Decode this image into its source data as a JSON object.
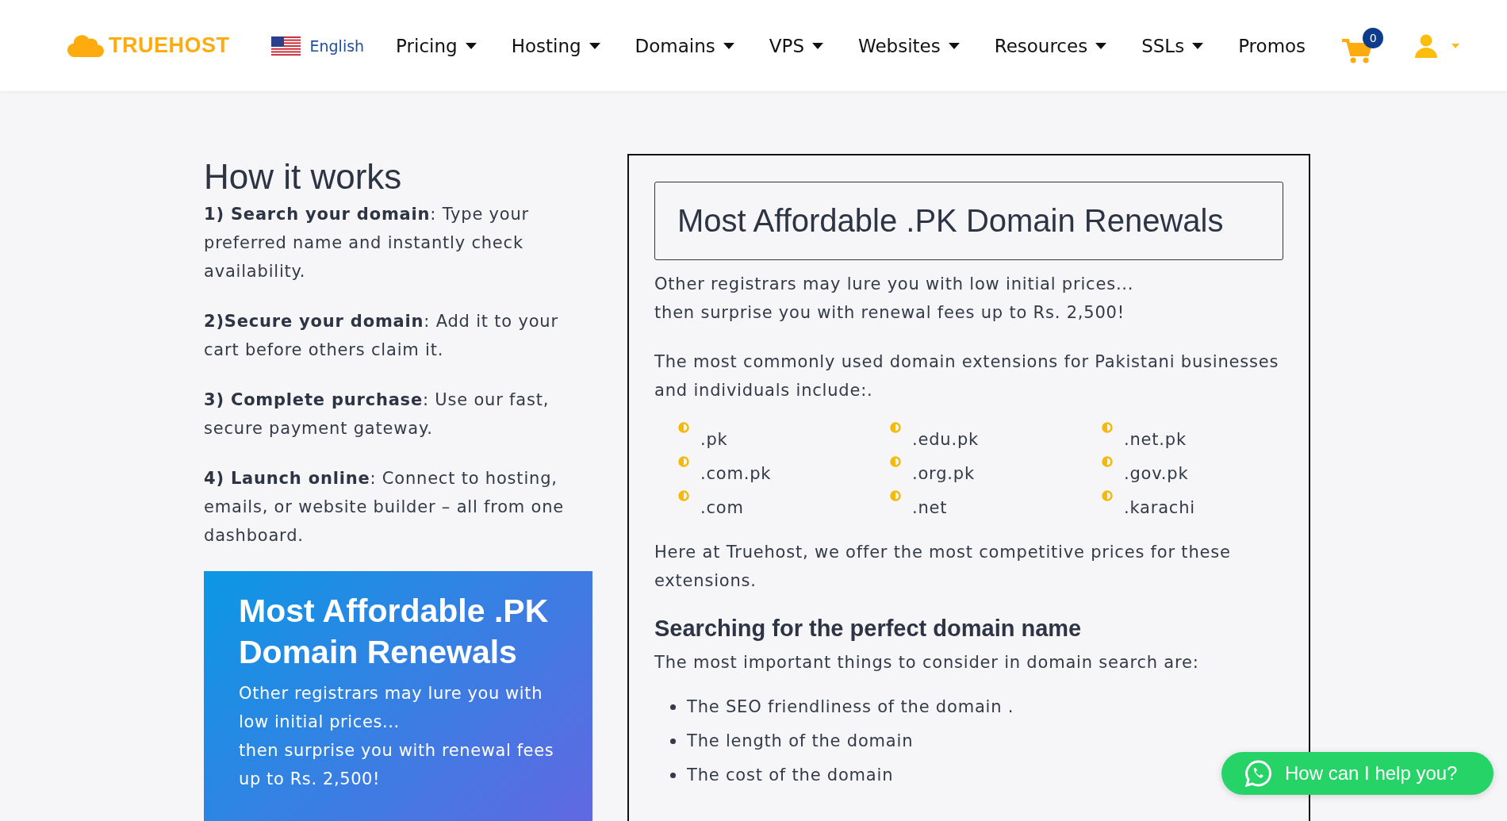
{
  "header": {
    "logo": "TRUEHOST",
    "language": "English",
    "nav": [
      {
        "label": "Pricing",
        "dropdown": true
      },
      {
        "label": "Hosting",
        "dropdown": true
      },
      {
        "label": "Domains",
        "dropdown": true
      },
      {
        "label": "VPS",
        "dropdown": true
      },
      {
        "label": "Websites",
        "dropdown": true
      },
      {
        "label": "Resources",
        "dropdown": true
      },
      {
        "label": "SSLs",
        "dropdown": true
      },
      {
        "label": "Promos",
        "dropdown": false
      }
    ],
    "cart_count": "0"
  },
  "how_it_works": {
    "title": "How it works",
    "steps": [
      "**1) Search your domain**: Type your preferred name and instantly check availability.",
      "**2)Secure your domain**: Add it to your cart before others claim it.",
      "**3) Complete purchase**: Use our fast, secure payment gateway.",
      "**4) Launch online**: Connect to hosting, emails, or website builder – all from one dashboard."
    ]
  },
  "promo_card": {
    "title": "Most Affordable .PK Domain Renewals",
    "lines": [
      "Other registrars may lure you with low initial prices...",
      "then surprise you with renewal fees up to Rs. 2,500!"
    ]
  },
  "main": {
    "title": "Most Affordable .PK Domain Renewals",
    "intro_lines": [
      "Other registrars may lure you with low initial prices...",
      "then surprise you with renewal fees up to Rs. 2,500!"
    ],
    "extensions_intro": "The most commonly used domain extensions for Pakistani businesses and individuals include:.",
    "extensions": [
      ".pk",
      ".edu.pk",
      ".net.pk",
      ".com.pk",
      ".org.pk",
      ".gov.pk",
      ".com",
      ".net",
      ".karachi"
    ],
    "offer": "Here at Truehost, we offer the most competitive prices for these extensions.",
    "section_heading": "Searching for the perfect domain name",
    "section_intro": "The most important things to consider in domain search are:",
    "considerations": [
      "The SEO friendliness of the domain .",
      "The length of the domain",
      "The cost of the domain"
    ]
  },
  "chat_button": {
    "label": "How can I help you?"
  }
}
